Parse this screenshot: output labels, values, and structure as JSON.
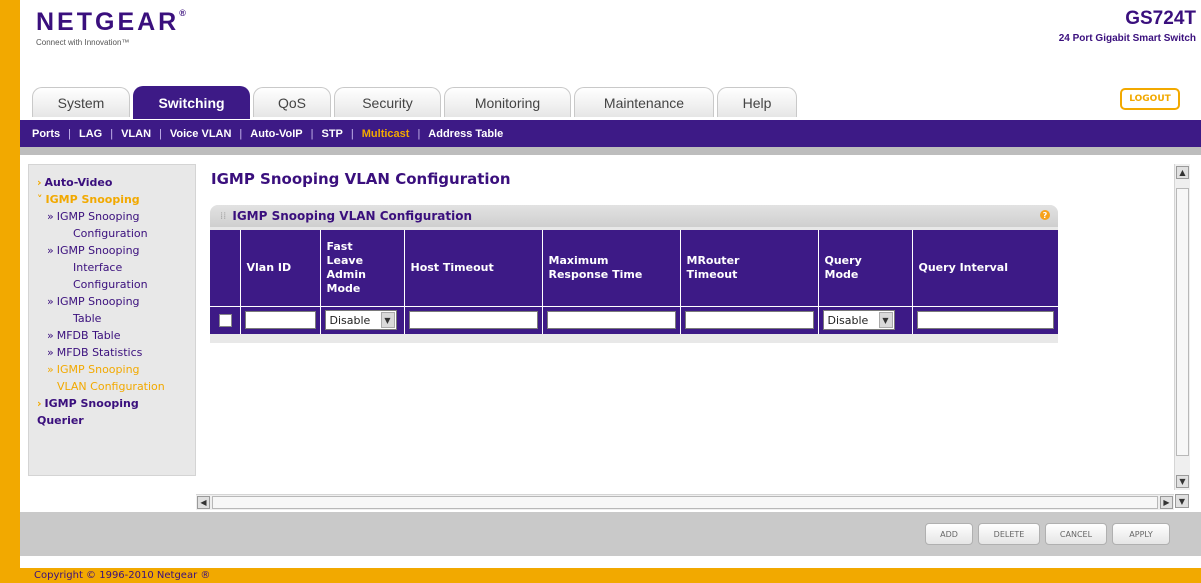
{
  "brand": {
    "logo": "NETGEAR",
    "logo_mark": "®",
    "tagline": "Connect with Innovation™",
    "model": "GS724T",
    "model_sub": "24 Port Gigabit Smart Switch"
  },
  "tabs": [
    {
      "label": "System"
    },
    {
      "label": "Switching"
    },
    {
      "label": "QoS"
    },
    {
      "label": "Security"
    },
    {
      "label": "Monitoring"
    },
    {
      "label": "Maintenance"
    },
    {
      "label": "Help"
    }
  ],
  "logout_label": "LOGOUT",
  "subnav": [
    {
      "label": "Ports"
    },
    {
      "label": "LAG"
    },
    {
      "label": "VLAN"
    },
    {
      "label": "Voice VLAN"
    },
    {
      "label": "Auto-VoIP"
    },
    {
      "label": "STP"
    },
    {
      "label": "Multicast"
    },
    {
      "label": "Address Table"
    }
  ],
  "leftnav": {
    "auto_video": "Auto-Video",
    "igmp_snooping": "IGMP Snooping",
    "items": [
      {
        "line1": "IGMP Snooping",
        "line2": "Configuration"
      },
      {
        "line1": "IGMP Snooping",
        "line2": "Interface",
        "line3": "Configuration"
      },
      {
        "line1": "IGMP Snooping",
        "line2": "Table"
      },
      {
        "line1": "MFDB Table"
      },
      {
        "line1": "MFDB Statistics"
      },
      {
        "line1": "IGMP Snooping",
        "line2": "VLAN Configuration"
      }
    ],
    "querier_line1": "IGMP Snooping",
    "querier_line2": "Querier"
  },
  "page_title": "IGMP Snooping VLAN Configuration",
  "panel": {
    "title": "IGMP Snooping VLAN Configuration",
    "help_icon": "?",
    "columns": {
      "vlan_id": "Vlan ID",
      "fast_leave": [
        "Fast",
        "Leave",
        "Admin",
        "Mode"
      ],
      "host_timeout": "Host Timeout",
      "max_response": [
        "Maximum",
        "Response Time"
      ],
      "mrouter": [
        "MRouter",
        "Timeout"
      ],
      "query_mode": [
        "Query",
        "Mode"
      ],
      "query_interval": "Query Interval"
    },
    "row": {
      "vlan_id": "",
      "fast_leave": "Disable",
      "host_timeout": "",
      "max_response": "",
      "mrouter": "",
      "query_mode": "Disable",
      "query_interval": ""
    }
  },
  "buttons": {
    "add": "ADD",
    "delete": "DELETE",
    "cancel": "CANCEL",
    "apply": "APPLY"
  },
  "copyright": "Copyright © 1996-2010 Netgear ®"
}
